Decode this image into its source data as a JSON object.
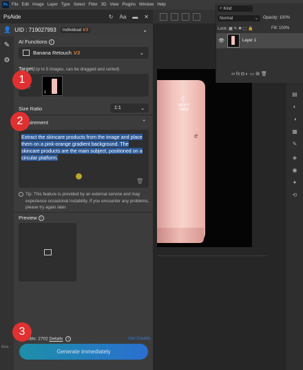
{
  "photoshop": {
    "menu": [
      "File",
      "Edit",
      "Image",
      "Layer",
      "Type",
      "Select",
      "Filter",
      "3D",
      "View",
      "Plugins",
      "Window",
      "Help"
    ],
    "layers_panel": {
      "kind_label": "Kind",
      "blend_mode": "Normal",
      "opacity_label": "Opacity:",
      "opacity_value": "100%",
      "lock_label": "Lock:",
      "fill_label": "Fill:",
      "fill_value": "100%",
      "layer_name": "Layer 1",
      "footer_icons": "∞  fx  ◘  ◐  ▭  ⊞  🗑"
    },
    "product": {
      "logo_text": "NIGHT CARE",
      "brand_partial": "e"
    },
    "left_strip_bottom": "Beta"
  },
  "aide": {
    "title": "PsAide",
    "uid": "UID : 719027993",
    "plan": "Individual",
    "plan_tag": "V3",
    "ai_functions_label": "AI Functions",
    "function_name": "Banana Retouch",
    "function_tag": "V3",
    "target_label_main": "Target",
    "target_label_hint": "(Up to 5 images, can be dragged and sorted)",
    "target_thumb_index": "1",
    "size_ratio_label": "Size Ratio",
    "size_ratio_value": "1:1",
    "requirement_label": "Requirement",
    "requirement_text": "Extract the skincare products from the image and place them on a pink-orange gradient background. The skincare products are the main subject, positioned on a circular platform.",
    "tip": "Tip: This feature is provided by an external service and may experience occasional instability. If you encounter any problems, please try again later.",
    "preview_label": "Preview",
    "credits_label": "Credits:",
    "credits_value": "2702",
    "details_link": "Details",
    "get_credits": "Get Credits",
    "generate_button": "Generate immediately"
  },
  "markers": [
    "1",
    "2",
    "3"
  ],
  "colors": {
    "marker": "#e03030",
    "accent": "#e07f3a",
    "button_start": "#1d8fa8",
    "button_end": "#2a6fd0",
    "selection": "#2d5a9a"
  }
}
